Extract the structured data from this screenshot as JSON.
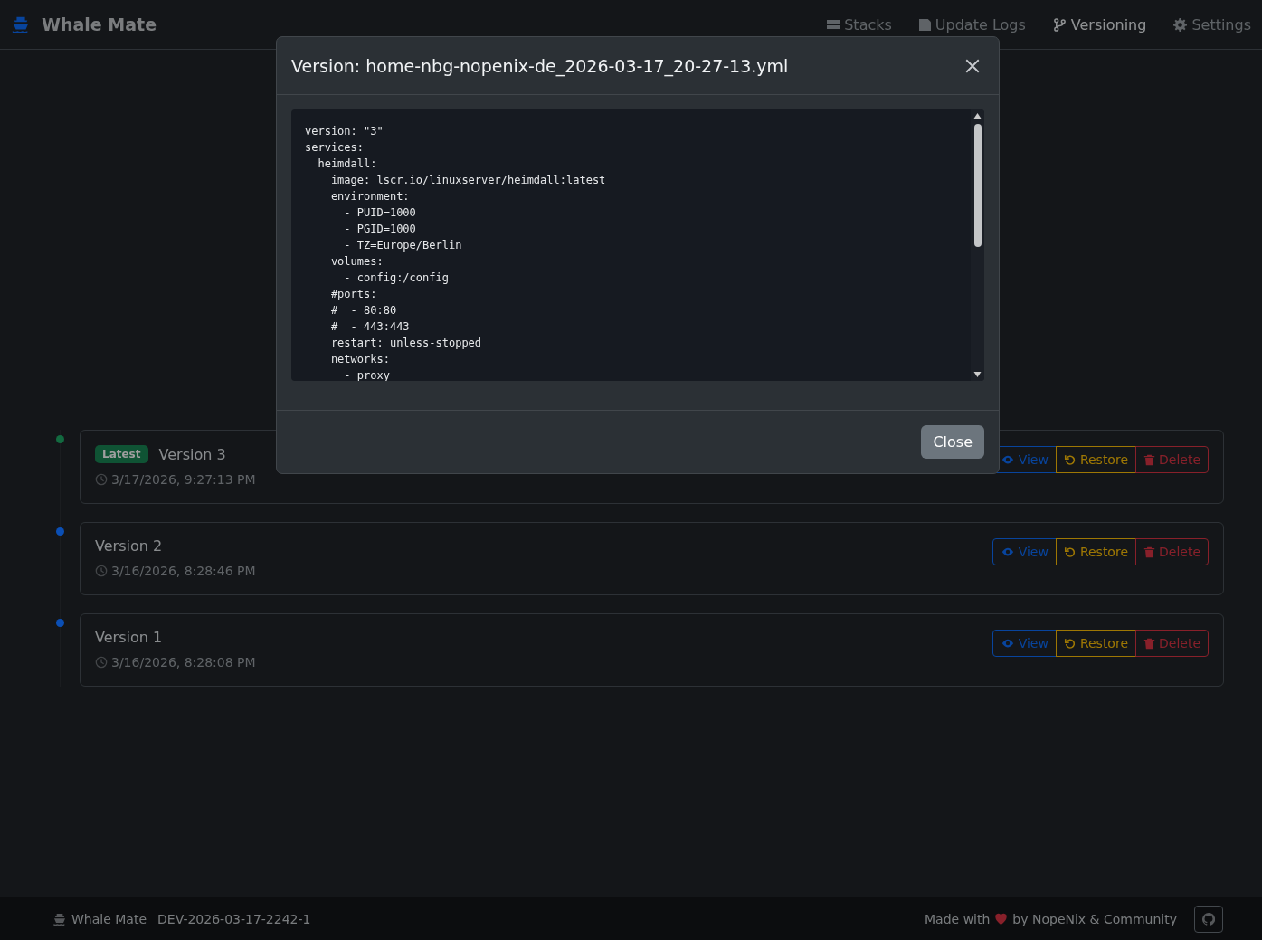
{
  "app": {
    "name": "Whale Mate"
  },
  "nav": [
    {
      "label": "Stacks",
      "selected": false
    },
    {
      "label": "Update Logs",
      "selected": false
    },
    {
      "label": "Versioning",
      "selected": true
    },
    {
      "label": "Settings",
      "selected": false
    }
  ],
  "versions": [
    {
      "title": "Version 3",
      "badge": "Latest",
      "timestamp": "3/17/2026, 9:27:13 PM",
      "color": "#136a40",
      "actions": [
        "View",
        "Restore",
        "Delete"
      ]
    },
    {
      "title": "Version 2",
      "timestamp": "3/16/2026, 8:28:46 PM",
      "color": "#0b4fb5",
      "actions": [
        "View",
        "Restore",
        "Delete"
      ]
    },
    {
      "title": "Version 1",
      "timestamp": "3/16/2026, 8:28:08 PM",
      "color": "#0b4fb5",
      "actions": [
        "View",
        "Restore",
        "Delete"
      ]
    }
  ],
  "modal": {
    "title": "Version: home-nbg-nopenix-de_2026-03-17_20-27-13.yml",
    "code": [
      "version: \"3\"",
      "services:",
      "  heimdall:",
      "    image: lscr.io/linuxserver/heimdall:latest",
      "    environment:",
      "      - PUID=1000",
      "      - PGID=1000",
      "      - TZ=Europe/Berlin",
      "    volumes:",
      "      - config:/config",
      "    #ports:",
      "    #  - 80:80",
      "    #  - 443:443",
      "    restart: unless-stopped",
      "    networks:",
      "      - proxy"
    ],
    "close": "Close"
  },
  "footer": {
    "app": "Whale Mate",
    "build": "DEV-2026-03-17-2242-1",
    "made_with": "Made with",
    "by": "by NopeNix & Community"
  }
}
